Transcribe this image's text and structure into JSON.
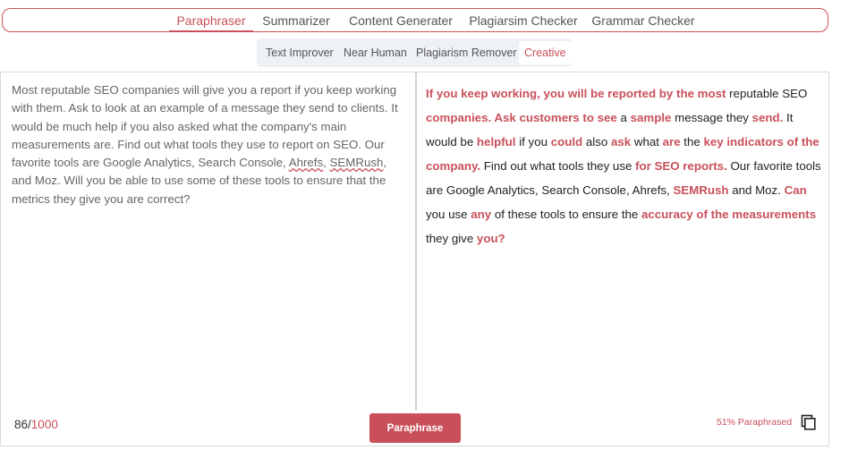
{
  "nav": {
    "tabs": [
      "Paraphraser",
      "Summarizer",
      "Content Generater",
      "Plagiarsim Checker",
      "Grammar Checker"
    ],
    "active": "Paraphraser"
  },
  "modes": {
    "tabs": [
      "Text Improver",
      "Near Human",
      "Plagiarism Remover",
      "Creative"
    ],
    "active": "Creative"
  },
  "input": {
    "p1": "Most reputable SEO companies will give you a report if you keep working with them. Ask to look at an example of a message they send to clients. It would be much help if you also asked what the company's main measurements are. Find out what tools they use to report on SEO. Our favorite tools are Google Analytics, Search Console, ",
    "w1": "Ahrefs",
    "p2": ", ",
    "w2": "SEMRush",
    "p3": ", and Moz. Will you be able to use some of these tools to ensure that the metrics they give you are correct?"
  },
  "output": {
    "segments": [
      {
        "t": "If you keep working, you will be reported by the most",
        "h": true
      },
      {
        "t": " reputable SEO ",
        "h": false
      },
      {
        "t": "companies. Ask customers to see",
        "h": true
      },
      {
        "t": " a ",
        "h": false
      },
      {
        "t": "sample",
        "h": true
      },
      {
        "t": " message they ",
        "h": false
      },
      {
        "t": "send.",
        "h": true
      },
      {
        "t": " It would be ",
        "h": false
      },
      {
        "t": "helpful",
        "h": true
      },
      {
        "t": " if you ",
        "h": false
      },
      {
        "t": "could",
        "h": true
      },
      {
        "t": " also ",
        "h": false
      },
      {
        "t": "ask",
        "h": true
      },
      {
        "t": " what ",
        "h": false
      },
      {
        "t": "are",
        "h": true
      },
      {
        "t": " the ",
        "h": false
      },
      {
        "t": "key indicators of the company.",
        "h": true
      },
      {
        "t": " Find out what tools they use ",
        "h": false
      },
      {
        "t": "for SEO reports.",
        "h": true
      },
      {
        "t": " Our favorite tools are Google Analytics, Search Console, Ahrefs, ",
        "h": false
      },
      {
        "t": "SEMRush",
        "h": true
      },
      {
        "t": " and Moz. ",
        "h": false
      },
      {
        "t": "Can",
        "h": true
      },
      {
        "t": " you use ",
        "h": false
      },
      {
        "t": "any",
        "h": true
      },
      {
        "t": " of these tools to ensure the ",
        "h": false
      },
      {
        "t": "accuracy of the measurements",
        "h": true
      },
      {
        "t": " they give ",
        "h": false
      },
      {
        "t": "you?",
        "h": true
      }
    ]
  },
  "footer": {
    "count": "86",
    "sep": "/",
    "max": "1000",
    "button": "Paraphrase",
    "percent": "51% Paraphrased"
  },
  "icons": {
    "copy": "copy-icon"
  },
  "colors": {
    "accent": "#c9505a"
  }
}
